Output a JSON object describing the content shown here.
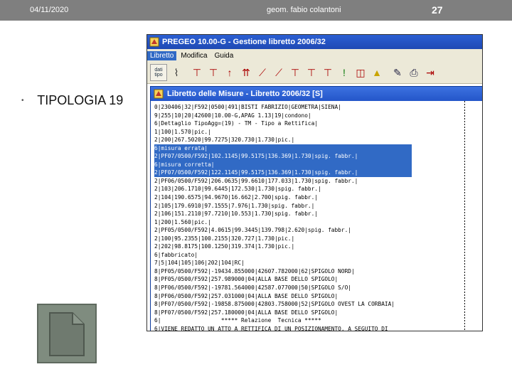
{
  "slide": {
    "date": "04/11/2020",
    "author": "geom. fabio colantoni",
    "page_number": "27",
    "bullet_text": "TIPOLOGIA 19"
  },
  "app": {
    "title": "PREGEO 10.00-G - Gestione libretto 2006/32",
    "menu": [
      "Libretto",
      "Modifica",
      "Guida"
    ],
    "toolbar_first_label": "dati tipo",
    "toolbar_icons": [
      "dati-tipo",
      "chart",
      "station-a",
      "station-b",
      "arrow-up",
      "arrows",
      "line-a",
      "line-b",
      "station-c",
      "station-d",
      "station-e",
      "warning-exclaim",
      "frame",
      "triangle",
      "edit",
      "print",
      "exit"
    ]
  },
  "libretto": {
    "title": "Libretto delle Misure - Libretto 2006/32 [S]",
    "lines": [
      {
        "text": "0|230406|32|F592|0500|491|BISTI FABRIZIO|GEOMETRA|SIENA|",
        "selected": false
      },
      {
        "text": "9|255|10|20|42600|10.00-G,APAG 1.13|19|condono|",
        "selected": false
      },
      {
        "text": "6|Dettaglio TipoAgg=(19) - TM - Tipo a Rettifica|",
        "selected": false
      },
      {
        "text": "1|100|1.570|pic.|",
        "selected": false
      },
      {
        "text": "2|200|267.5020|99.7275|320.730|1.730|pic.|",
        "selected": false
      },
      {
        "text": "6|misura errata|",
        "selected": true
      },
      {
        "text": "2|PF07/0500/F592|102.1145|99.5175|136.369|1.730|spig. fabbr.|",
        "selected": true
      },
      {
        "text": "6|misura corretta|",
        "selected": true
      },
      {
        "text": "2|PF07/0500/F592|122.1145|99.5175|136.369|1.730|spig. fabbr.|",
        "selected": true
      },
      {
        "text": "2|PF06/0500/F592|206.0635|99.6610|177.033|1.730|spig. fabbr.|",
        "selected": false
      },
      {
        "text": "2|103|206.1710|99.6445|172.530|1.730|spig. fabbr.|",
        "selected": false
      },
      {
        "text": "2|104|190.6575|94.9670|16.662|2.700|spig. fabbr.|",
        "selected": false
      },
      {
        "text": "2|105|179.6910|97.1555|7.976|1.730|spig. fabbr.|",
        "selected": false
      },
      {
        "text": "2|106|151.2110|97.7210|10.553|1.730|spig. fabbr.|",
        "selected": false
      },
      {
        "text": "1|200|1.560|pic.|",
        "selected": false
      },
      {
        "text": "2|PF05/0500/F592|4.0615|99.3445|139.798|2.620|spig. fabbr.|",
        "selected": false
      },
      {
        "text": "2|100|95.2355|100.2155|320.727|1.730|pic.|",
        "selected": false
      },
      {
        "text": "2|202|98.8175|100.1250|319.374|1.730|pic.|",
        "selected": false
      },
      {
        "text": "6|fabbricato|",
        "selected": false
      },
      {
        "text": "7|5|104|105|106|202|104|RC|",
        "selected": false
      },
      {
        "text": "8|PF05/0500/F592|-19434.855000|42607.782000|62|SPIGOLO NORD|",
        "selected": false
      },
      {
        "text": "8|PF05/0500/F592|257.989000|04|ALLA BASE DELLO SPIGOLO|",
        "selected": false
      },
      {
        "text": "8|PF06/0500/F592|-19781.564000|42587.077000|50|SPIGOLO S/O|",
        "selected": false
      },
      {
        "text": "8|PF06/0500/F592|257.031000|04|ALLA BASE DELLO SPIGOLO|",
        "selected": false
      },
      {
        "text": "8|PF07/0500/F592|-19858.875000|42803.758000|52|SPIGOLO OVEST LA CORBAIA|",
        "selected": false
      },
      {
        "text": "8|PF07/0500/F592|257.180000|04|ALLA BASE DELLO SPIGOLO|",
        "selected": false
      },
      {
        "text": "6|                  ***** Relazione  Tecnica *****",
        "selected": false
      },
      {
        "text": "6|VIENE REDATTO UN ATTO A RETTIFICA DI UN POSIZIONAMENTO, A SEGUITO DI",
        "selected": false
      }
    ]
  },
  "colors": {
    "header_bg": "#7f7f7f",
    "selection": "#316ac5",
    "title_bar": "#1f49b4"
  }
}
